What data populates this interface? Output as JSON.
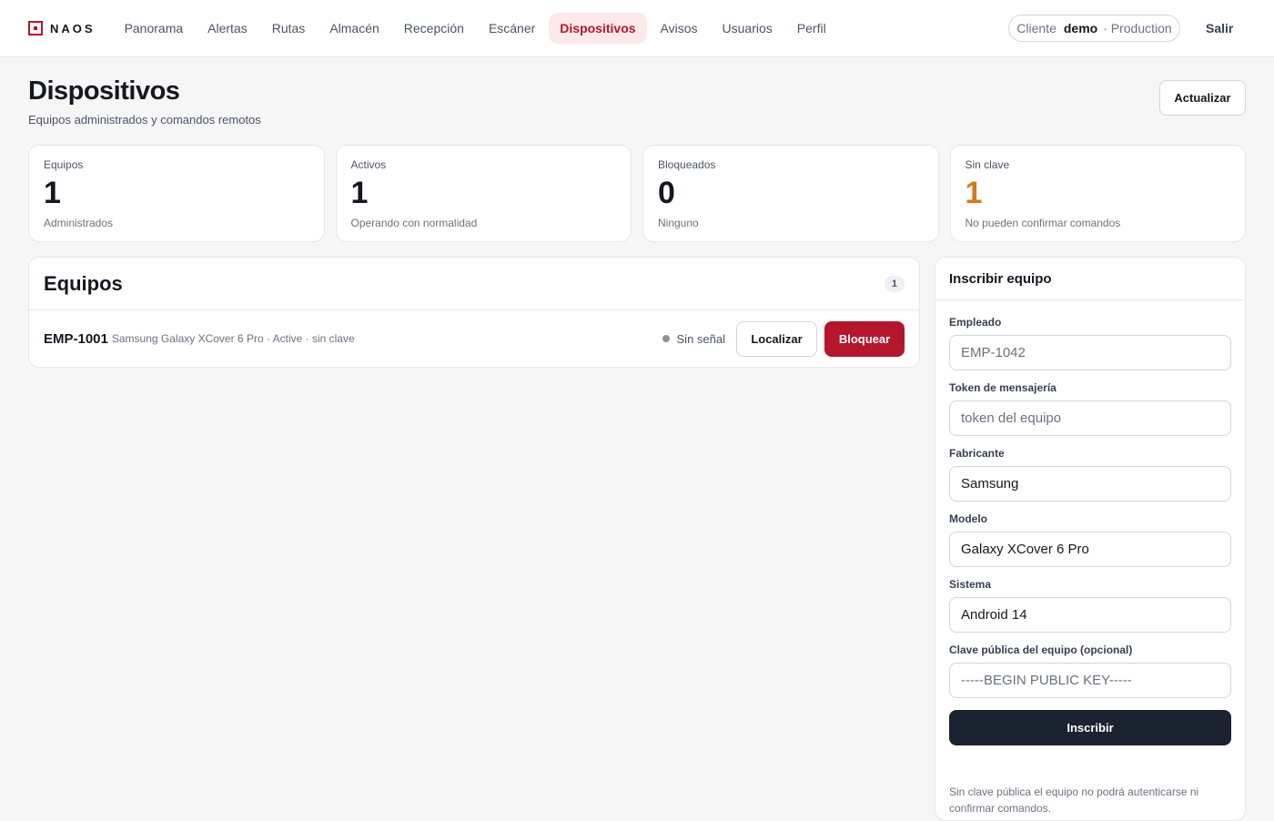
{
  "brand": {
    "name": "NAOS",
    "accent": "#b5162b"
  },
  "nav": [
    {
      "label": "Panorama",
      "active": false
    },
    {
      "label": "Alertas",
      "active": false
    },
    {
      "label": "Rutas",
      "active": false
    },
    {
      "label": "Almacén",
      "active": false
    },
    {
      "label": "Recepción",
      "active": false
    },
    {
      "label": "Escáner",
      "active": false
    },
    {
      "label": "Dispositivos",
      "active": true
    },
    {
      "label": "Avisos",
      "active": false
    },
    {
      "label": "Usuarios",
      "active": false
    },
    {
      "label": "Perfil",
      "active": false
    }
  ],
  "client": {
    "label": "Cliente",
    "name": "demo",
    "env": "· Production"
  },
  "logout_label": "Salir",
  "page": {
    "title": "Dispositivos",
    "subtitle": "Equipos administrados y comandos remotos",
    "refresh_label": "Actualizar"
  },
  "stats": [
    {
      "label": "Equipos",
      "value": "1",
      "sub": "Administrados",
      "color": "#141820"
    },
    {
      "label": "Activos",
      "value": "1",
      "sub": "Operando con normalidad",
      "color": "#141820"
    },
    {
      "label": "Bloqueados",
      "value": "0",
      "sub": "Ninguno",
      "color": "#141820"
    },
    {
      "label": "Sin clave",
      "value": "1",
      "sub": "No pueden confirmar comandos",
      "color": "#d47a18"
    }
  ],
  "devices": {
    "title": "Equipos",
    "count": "1",
    "rows": [
      {
        "id": "EMP-1001",
        "meta": "Samsung Galaxy XCover 6 Pro · Active · sin clave",
        "signal": "Sin señal",
        "locate_label": "Localizar",
        "block_label": "Bloquear"
      }
    ]
  },
  "enroll": {
    "title": "Inscribir equipo",
    "fields": [
      {
        "label": "Empleado",
        "value": "",
        "placeholder": "EMP-1042"
      },
      {
        "label": "Token de mensajería",
        "value": "",
        "placeholder": "token del equipo"
      },
      {
        "label": "Fabricante",
        "value": "Samsung",
        "placeholder": ""
      },
      {
        "label": "Modelo",
        "value": "Galaxy XCover 6 Pro",
        "placeholder": ""
      },
      {
        "label": "Sistema",
        "value": "Android 14",
        "placeholder": ""
      },
      {
        "label": "Clave pública del equipo (opcional)",
        "value": "",
        "placeholder": "-----BEGIN PUBLIC KEY-----"
      }
    ],
    "submit_label": "Inscribir",
    "note": "Sin clave pública el equipo no podrá autenticarse ni confirmar comandos."
  }
}
